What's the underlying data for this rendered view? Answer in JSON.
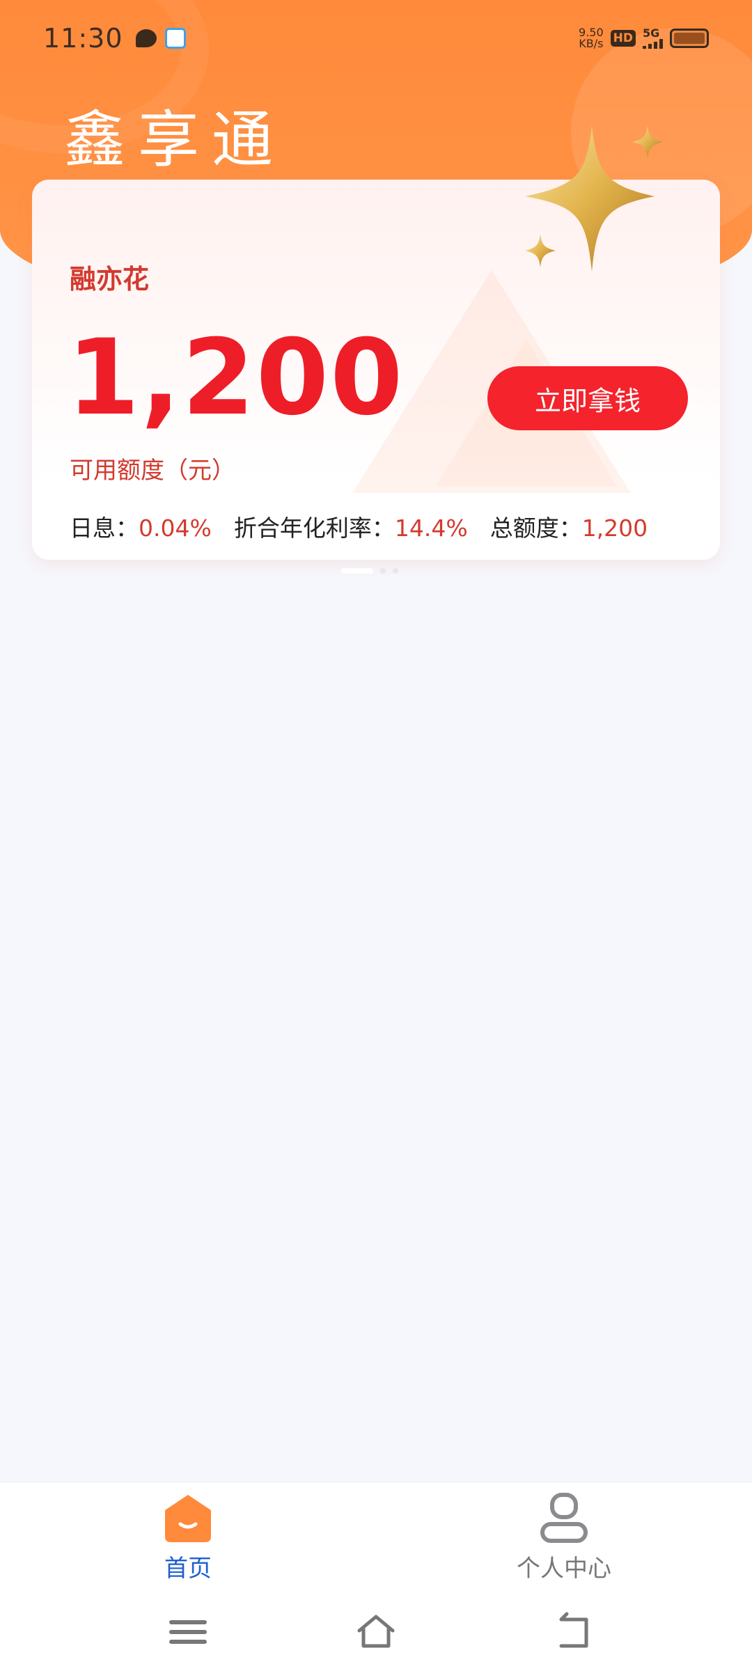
{
  "status_bar": {
    "time": "11:30",
    "net_speed_value": "9.50",
    "net_speed_unit": "KB/s",
    "hd": "HD",
    "network": "5G"
  },
  "app": {
    "title": "鑫享通"
  },
  "card": {
    "product_name": "融亦花",
    "amount": "1,200",
    "amount_label": "可用额度（元）",
    "cta_label": "立即拿钱",
    "rates": [
      {
        "label": "日息：",
        "value": "0.04%"
      },
      {
        "label": "折合年化利率：",
        "value": "14.4%"
      },
      {
        "label": "总额度：",
        "value": "1,200"
      }
    ]
  },
  "pager": {
    "count": 3,
    "active_index": 0
  },
  "bottom_nav": {
    "items": [
      {
        "label": "首页",
        "icon": "home-icon",
        "active": true
      },
      {
        "label": "个人中心",
        "icon": "user-icon",
        "active": false
      }
    ]
  },
  "system_nav": {
    "icons": [
      "menu-icon",
      "home-outline-icon",
      "back-icon"
    ]
  },
  "colors": {
    "header_orange": "#ff8a3b",
    "accent_red": "#f4232c",
    "text_red": "#d33a2e",
    "nav_active_blue": "#1f5ed4"
  }
}
